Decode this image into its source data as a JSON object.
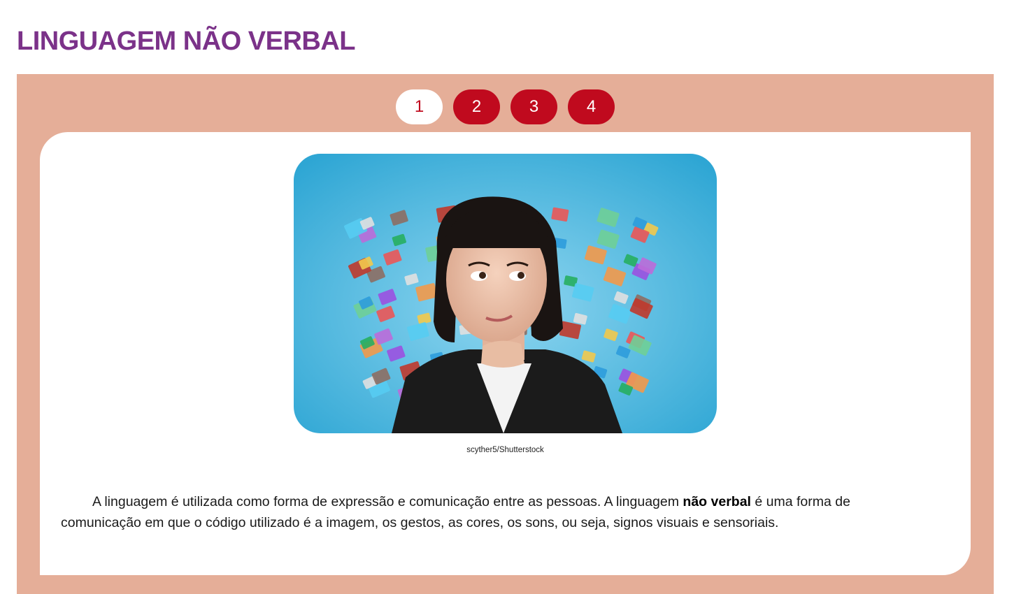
{
  "page": {
    "title": "LINGUAGEM NÃO VERBAL"
  },
  "tabs": [
    {
      "label": "1",
      "active": true
    },
    {
      "label": "2",
      "active": false
    },
    {
      "label": "3",
      "active": false
    },
    {
      "label": "4",
      "active": false
    }
  ],
  "content": {
    "image_credit": "scyther5/Shutterstock",
    "paragraph": {
      "part1": "A linguagem é utilizada como forma de expressão e comunicação entre as pessoas. A linguagem ",
      "bold": "não verbal",
      "part2": " é uma forma de comunicação em que o código utilizado é a imagem, os gestos, as cores, os sons, ou seja, signos visuais e sensoriais."
    }
  },
  "colors": {
    "title": "#7b3289",
    "panel_background": "#e5ae98",
    "tab_active_bg": "#ffffff",
    "tab_inactive_bg": "#c00a1e",
    "photo_background": "#45b3d9"
  }
}
